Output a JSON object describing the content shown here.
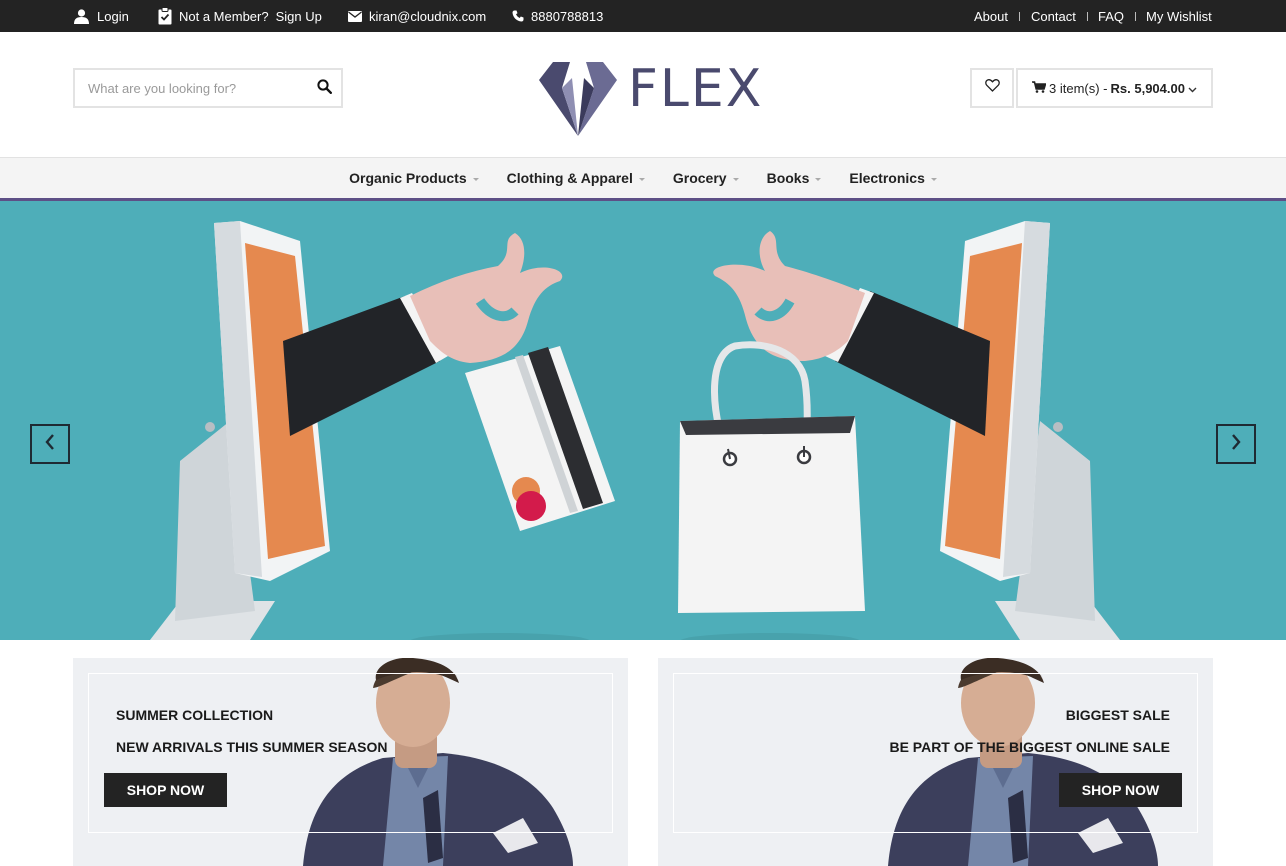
{
  "topbar": {
    "login": "Login",
    "member_text": "Not a Member?",
    "signup": "Sign Up",
    "email": "kiran@cloudnix.com",
    "phone": "8880788813",
    "links": [
      "About",
      "Contact",
      "FAQ",
      "My Wishlist"
    ]
  },
  "header": {
    "search_placeholder": "What are you looking for?",
    "logo_text": "FLEX",
    "cart_count": "3 item(s) -",
    "cart_total": "Rs. 5,904.00"
  },
  "nav": {
    "items": [
      "Organic Products",
      "Clothing & Apparel",
      "Grocery",
      "Books",
      "Electronics"
    ]
  },
  "banners": [
    {
      "title": "SUMMER COLLECTION",
      "subtitle": "NEW ARRIVALS THIS SUMMER SEASON",
      "button": "SHOP NOW"
    },
    {
      "title": "BIGGEST SALE",
      "subtitle": "BE PART OF THE BIGGEST ONLINE SALE",
      "button": "SHOP NOW"
    }
  ],
  "colors": {
    "topbar": "#232323",
    "accent": "#5d4f86",
    "hero_bg": "#4eaeb9",
    "monitor_screen": "#e5894f",
    "button_dark": "#232323"
  },
  "icons": [
    "user-icon",
    "clipboard-icon",
    "envelope-icon",
    "phone-icon",
    "search-icon",
    "heart-icon",
    "cart-icon",
    "chevron-down-icon",
    "chevron-left-icon",
    "chevron-right-icon"
  ]
}
